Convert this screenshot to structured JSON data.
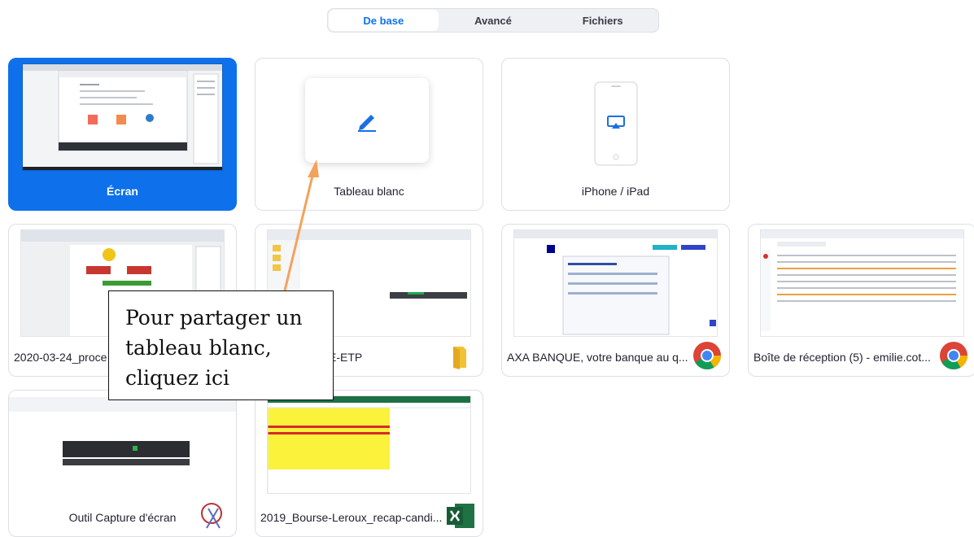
{
  "tabs": [
    {
      "label": "De base",
      "active": true
    },
    {
      "label": "Avancé",
      "active": false
    },
    {
      "label": "Fichiers",
      "active": false
    }
  ],
  "tiles": {
    "screen": {
      "label": "Écran",
      "selected": true
    },
    "whiteboard": {
      "label": "Tableau blanc"
    },
    "iphone": {
      "label": "iPhone / iPad"
    },
    "word_doc": {
      "label": "2020-03-24_proce",
      "app_icon": "word-icon"
    },
    "folder": {
      "label": "E-ETP",
      "app_icon": "folder-icon"
    },
    "axa": {
      "label": "AXA BANQUE, votre banque au q...",
      "app_icon": "chrome-icon"
    },
    "mail": {
      "label": "Boîte de réception (5) - emilie.cot...",
      "app_icon": "chrome-icon"
    },
    "snipping": {
      "label": "Outil Capture d'écran",
      "app_icon": "snipping-tool-icon"
    },
    "excel": {
      "label": "2019_Bourse-Leroux_recap-candi...",
      "app_icon": "excel-icon"
    }
  },
  "callout": {
    "line1": "Pour partager un",
    "line2": "tableau blanc,",
    "line3": "cliquez ici"
  },
  "colors": {
    "accent": "#0e72ed",
    "selected_tile": "#0e71eb",
    "arrow": "#f4a25a"
  }
}
